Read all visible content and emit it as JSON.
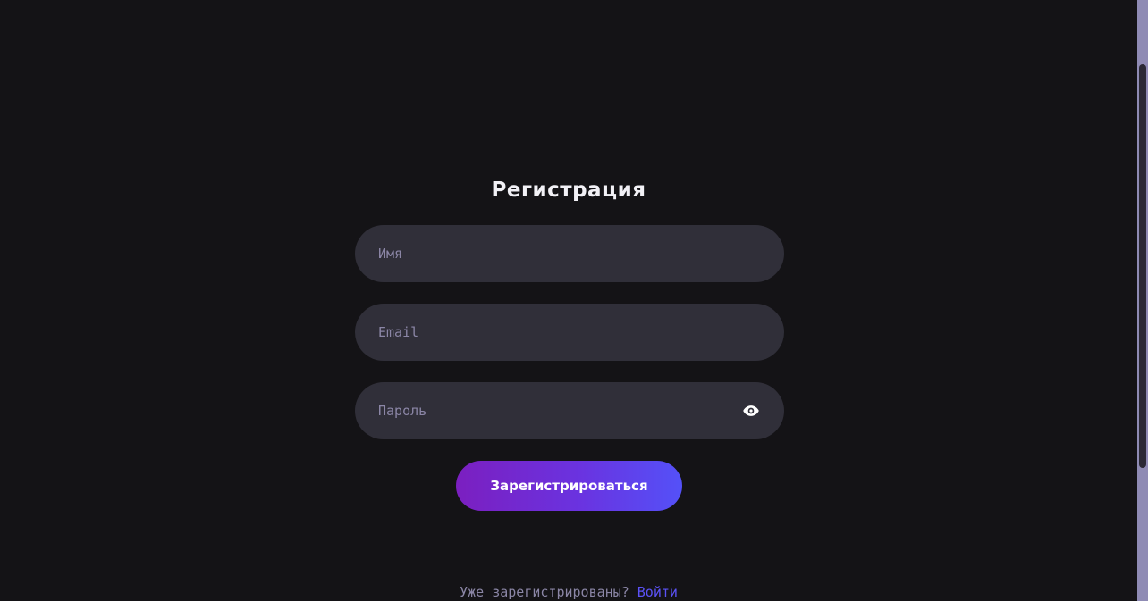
{
  "form": {
    "title": "Регистрация",
    "name_placeholder": "Имя",
    "email_placeholder": "Email",
    "password_placeholder": "Пароль",
    "password_toggle_icon": "eye-icon",
    "submit_label": "Зарегистрироваться"
  },
  "footer": {
    "prompt": "Уже зарегистрированы?",
    "login_link": "Войти"
  },
  "colors": {
    "background": "#141316",
    "field_background": "#302f39",
    "placeholder": "#8b86a6",
    "link": "#5b52f6",
    "button_gradient_start": "#7b1fc0",
    "button_gradient_end": "#5451f8"
  }
}
